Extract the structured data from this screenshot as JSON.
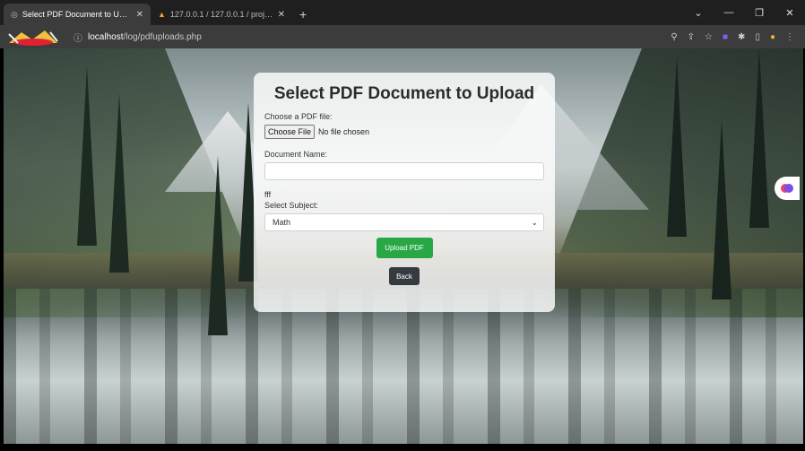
{
  "browser": {
    "tabs": [
      {
        "title": "Select PDF Document to Upload",
        "active": true
      },
      {
        "title": "127.0.0.1 / 127.0.0.1 / project / ",
        "active": false
      }
    ],
    "new_tab": "+",
    "address": {
      "host": "localhost",
      "path": "/log/pdfuploads.php"
    }
  },
  "form": {
    "title": "Select PDF Document to Upload",
    "file_label": "Choose a PDF file:",
    "file_button": "Choose File",
    "file_status": "No file chosen",
    "doc_name_label": "Document Name:",
    "doc_name_value": "",
    "echo_text": "fff",
    "subject_label": "Select Subject:",
    "subject_selected": "Math",
    "upload_button": "Upload PDF",
    "back_button": "Back"
  },
  "colors": {
    "upload_button": "#28a745",
    "back_button": "#343a40"
  }
}
